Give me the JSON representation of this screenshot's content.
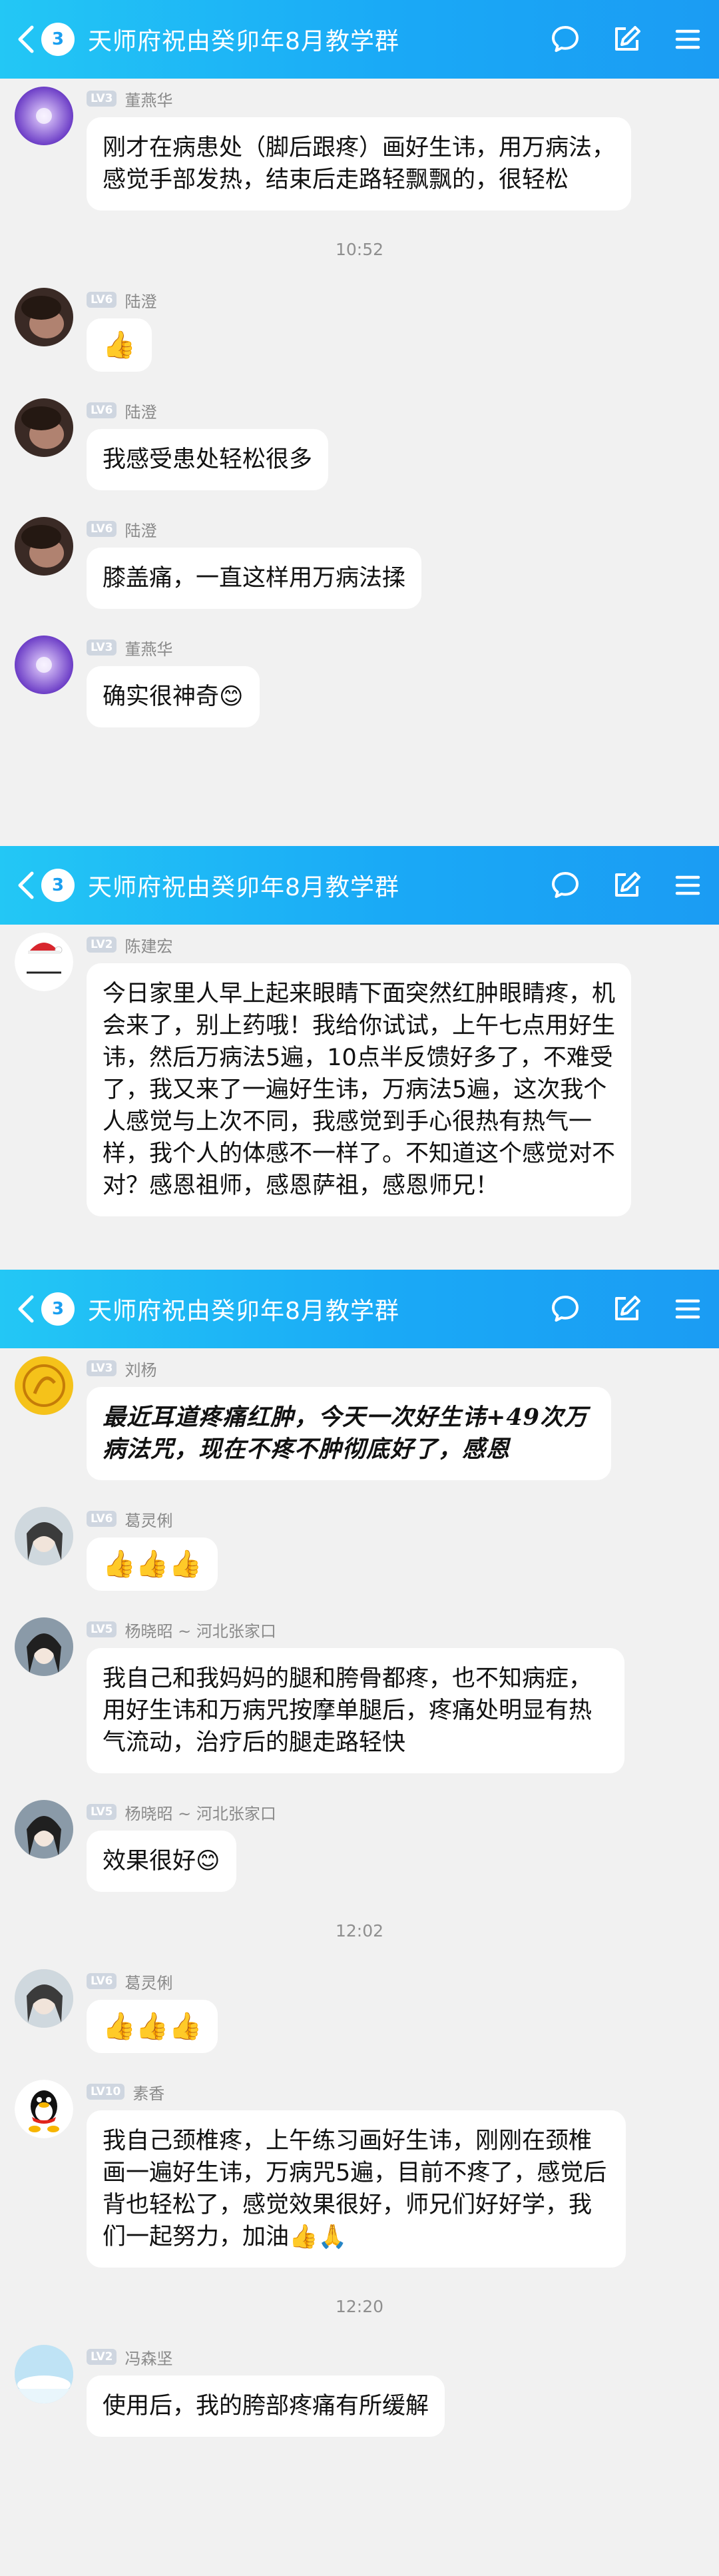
{
  "sections": [
    {
      "header": {
        "badge": "3",
        "title": "天师府祝由癸卯年8月教学群"
      },
      "messages": [
        {
          "level": "LV3",
          "sender": "董燕华",
          "text": "刚才在病患处（脚后跟疼）画好生讳，用万病法，感觉手部发热，结束后走路轻飘飘的，很轻松"
        },
        {
          "time": "10:52"
        },
        {
          "level": "LV6",
          "sender": "陆澄",
          "text": "👍"
        },
        {
          "level": "LV6",
          "sender": "陆澄",
          "text": "我感受患处轻松很多"
        },
        {
          "level": "LV6",
          "sender": "陆澄",
          "text": "膝盖痛，一直这样用万病法揉"
        },
        {
          "level": "LV3",
          "sender": "董燕华",
          "text": "确实很神奇😊"
        }
      ]
    },
    {
      "header": {
        "badge": "3",
        "title": "天师府祝由癸卯年8月教学群"
      },
      "messages": [
        {
          "level": "LV2",
          "sender": "陈建宏",
          "text": "今日家里人早上起来眼睛下面突然红肿眼睛疼，机会来了，别上药哦！我给你试试，上午七点用好生讳，然后万病法5遍，10点半反馈好多了，不难受了，我又来了一遍好生讳，万病法5遍，这次我个人感觉与上次不同，我感觉到手心很热有热气一样，我个人的体感不一样了。不知道这个感觉对不对？感恩祖师，感恩萨祖，感恩师兄！"
        }
      ]
    },
    {
      "header": {
        "badge": "3",
        "title": "天师府祝由癸卯年8月教学群"
      },
      "messages": [
        {
          "level": "LV3",
          "sender": "刘杨",
          "text": "最近耳道疼痛红肿，今天一次好生讳+49次万病法咒，现在不疼不肿彻底好了，感恩"
        },
        {
          "level": "LV6",
          "sender": "葛灵俐",
          "text": "👍👍👍"
        },
        {
          "level": "LV5",
          "sender": "杨晓昭 ~ 河北张家口",
          "text": "我自己和我妈妈的腿和胯骨都疼，也不知病症，用好生讳和万病咒按摩单腿后，疼痛处明显有热气流动，治疗后的腿走路轻快"
        },
        {
          "level": "LV5",
          "sender": "杨晓昭 ~ 河北张家口",
          "text": "效果很好😊"
        },
        {
          "time": "12:02"
        },
        {
          "level": "LV6",
          "sender": "葛灵俐",
          "text": "👍👍👍"
        },
        {
          "level": "LV10",
          "sender": "素香",
          "text": "我自己颈椎疼，上午练习画好生讳，刚刚在颈椎画一遍好生讳，万病咒5遍，目前不疼了，感觉后背也轻松了，感觉效果很好，师兄们好好学，我们一起努力，加油👍🙏"
        },
        {
          "time": "12:20"
        },
        {
          "level": "LV2",
          "sender": "冯森坚",
          "text": "使用后，我的胯部疼痛有所缓解"
        }
      ]
    }
  ],
  "colors": {
    "header_start": "#23c7f5",
    "header_end": "#1b9cf3",
    "background": "#f1f1f1"
  },
  "icons": [
    "back-chevron-icon",
    "chat-bubble-icon",
    "edit-icon",
    "menu-icon"
  ]
}
